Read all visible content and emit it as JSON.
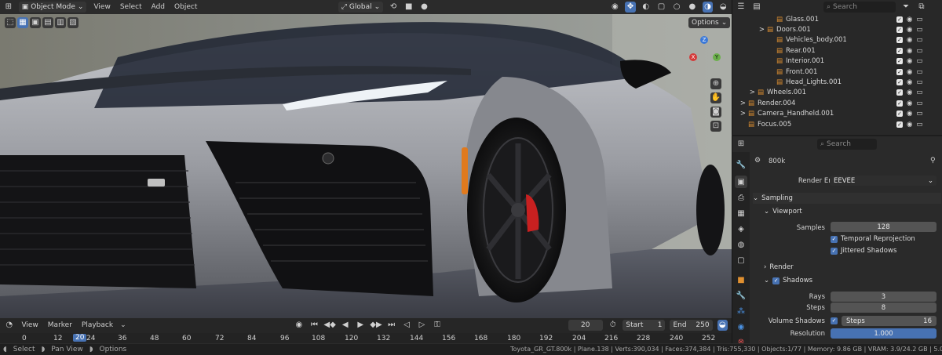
{
  "header": {
    "mode": "Object Mode",
    "menus": [
      "View",
      "Select",
      "Add",
      "Object"
    ],
    "transform_orientation": "Global"
  },
  "viewport": {
    "options_label": "Options",
    "gizmo": {
      "z": "Z",
      "y": "Y",
      "x": "X"
    }
  },
  "timeline": {
    "menus": [
      "View",
      "Marker",
      "Playback"
    ],
    "current_frame": "20",
    "start_label": "Start",
    "start": "1",
    "end_label": "End",
    "end": "250",
    "ruler_labels": [
      "0",
      "12",
      "20",
      "24",
      "36",
      "48",
      "60",
      "72",
      "84",
      "96",
      "108",
      "120",
      "132",
      "144",
      "156",
      "168",
      "180",
      "192",
      "204",
      "216",
      "228",
      "240",
      "252"
    ]
  },
  "status": {
    "left": [
      "Select",
      "Pan View",
      "Options"
    ],
    "right": "Toyota_GR_GT.800k | Plane.138 | Verts:390,034 | Faces:374,384 | Tris:755,330 | Objects:1/77 | Memory: 9.86 GB | VRAM: 3.9/24.2 GB | 5.0.0"
  },
  "outliner": {
    "search_placeholder": "Search",
    "items": [
      {
        "name": "Glass.001",
        "indent": 3
      },
      {
        "name": "Doors.001",
        "indent": 2,
        "expand": ">"
      },
      {
        "name": "Vehicles_body.001",
        "indent": 3
      },
      {
        "name": "Rear.001",
        "indent": 3
      },
      {
        "name": "Interior.001",
        "indent": 3
      },
      {
        "name": "Front.001",
        "indent": 3
      },
      {
        "name": "Head_Lights.001",
        "indent": 3
      },
      {
        "name": "Wheels.001",
        "indent": 1,
        "expand": ">"
      },
      {
        "name": "Render.004",
        "indent": 0,
        "expand": ">"
      },
      {
        "name": "Camera_Handheld.001",
        "indent": 0,
        "expand": ">"
      },
      {
        "name": "Focus.005",
        "indent": 0
      }
    ]
  },
  "properties": {
    "search_placeholder": "Search",
    "scene_name": "800k",
    "render_engine_label": "Render Engine",
    "render_engine": "EEVEE",
    "sampling_label": "Sampling",
    "viewport_label": "Viewport",
    "samples_label": "Samples",
    "samples": "128",
    "temporal_reprojection": "Temporal Reprojection",
    "jittered_shadows": "Jittered Shadows",
    "render_label": "Render",
    "shadows_label": "Shadows",
    "rays_label": "Rays",
    "rays": "3",
    "steps_label": "Steps",
    "steps": "8",
    "volume_shadows_label": "Volume Shadows",
    "volume_steps_label": "Steps",
    "volume_steps": "16",
    "resolution_label": "Resolution",
    "resolution": "1.000"
  },
  "colors": {
    "accent": "#4772b3",
    "car_body": "#9a9ca2"
  }
}
